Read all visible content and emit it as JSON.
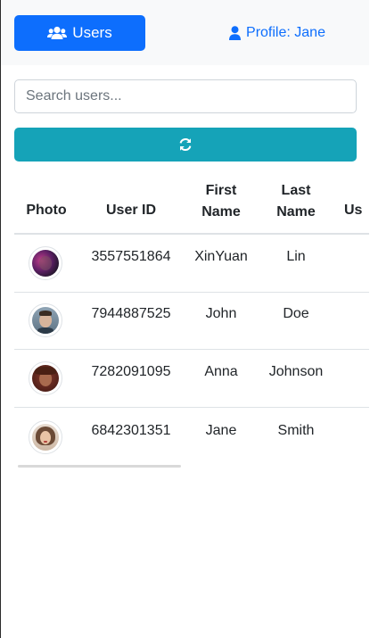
{
  "nav": {
    "users_label": "Users",
    "profile_label": "Profile: Jane"
  },
  "search": {
    "placeholder": "Search users...",
    "value": ""
  },
  "refresh": {
    "icon": "refresh-icon"
  },
  "table": {
    "headers": [
      "Photo",
      "User ID",
      "First Name",
      "Last Name",
      "Us"
    ],
    "rows": [
      {
        "user_id": "3557551864",
        "first": "XinYuan",
        "last": "Lin",
        "avatar": "portrait-dark-pink"
      },
      {
        "user_id": "7944887525",
        "first": "John",
        "last": "Doe",
        "avatar": "portrait-man"
      },
      {
        "user_id": "7282091095",
        "first": "Anna",
        "last": "Johnson",
        "avatar": "portrait-woman-red"
      },
      {
        "user_id": "6842301351",
        "first": "Jane",
        "last": "Smith",
        "avatar": "portrait-woman-light"
      }
    ]
  },
  "colors": {
    "primary": "#0d6efd",
    "info": "#15a3b8",
    "nav_bg": "#f8f9fa",
    "border": "#dee2e6"
  }
}
